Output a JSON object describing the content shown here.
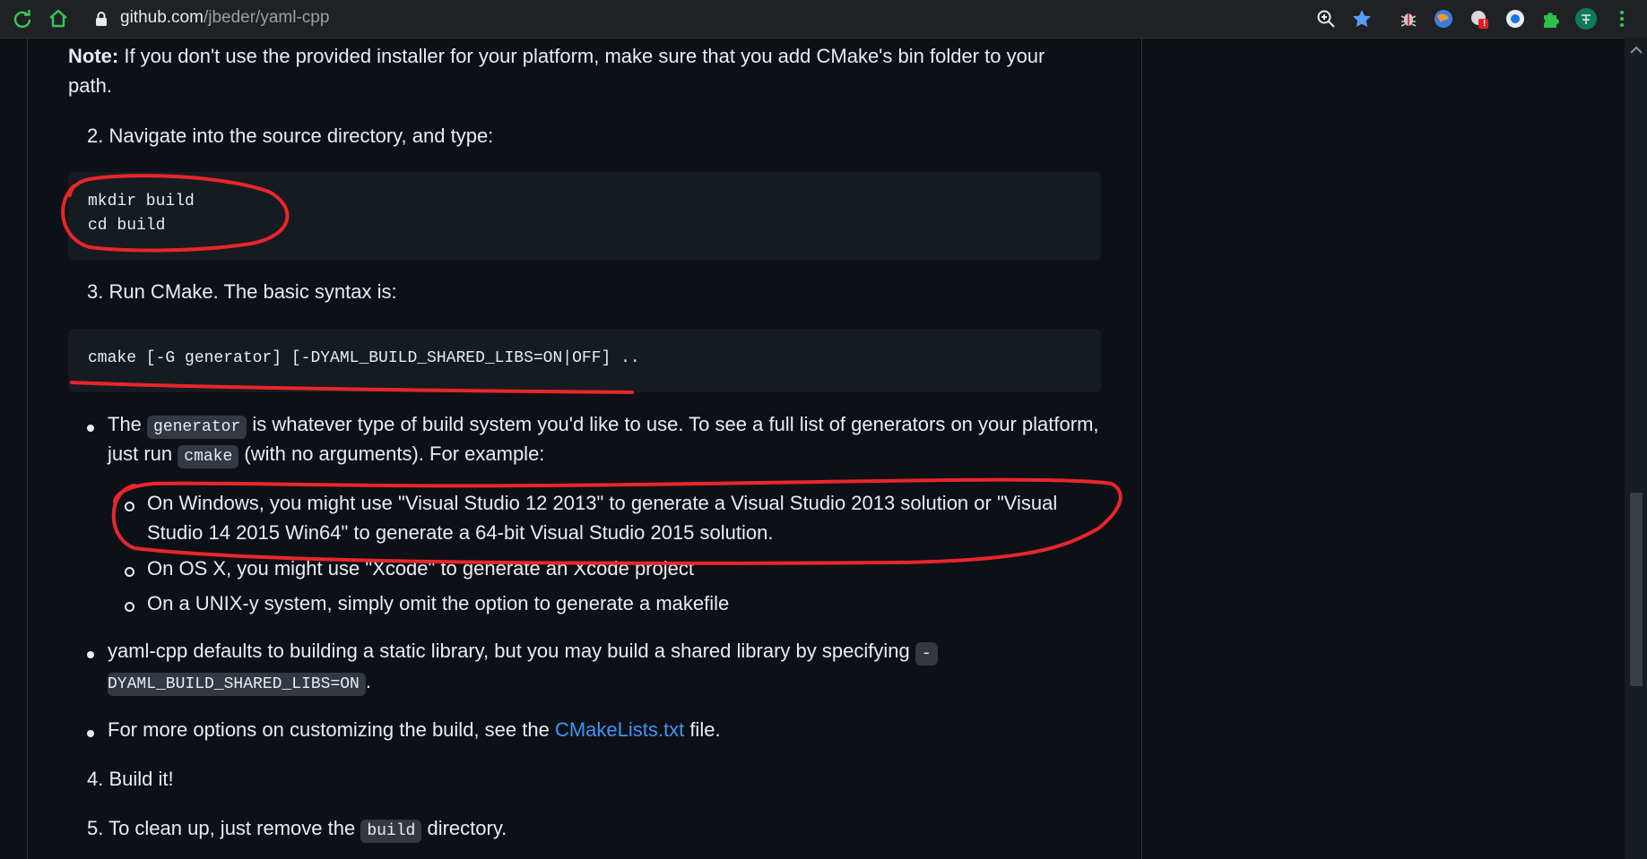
{
  "browser": {
    "url_host": "github.com",
    "url_path": "/jbeder/yaml-cpp",
    "extension_badge": "!"
  },
  "readme": {
    "note_label": "Note:",
    "note_text_line1": " If you don't use the provided installer for your platform, make sure that you add CMake's bin folder to your",
    "note_text_line2": "path.",
    "step2": "2. Navigate into the source directory, and type:",
    "step2_code": [
      "mkdir build",
      "cd build"
    ],
    "step3": "3. Run CMake. The basic syntax is:",
    "step3_code": "cmake [-G generator] [-DYAML_BUILD_SHARED_LIBS=ON|OFF] ..",
    "bullet1": {
      "pre": "The ",
      "code1": "generator",
      "mid": " is whatever type of build system you'd like to use. To see a full list of generators on your platform,",
      "line2_pre": "just run ",
      "code2": "cmake",
      "line2_post": " (with no arguments). For example:"
    },
    "sub1_line1": "On Windows, you might use \"Visual Studio 12 2013\" to generate a Visual Studio 2013 solution or \"Visual",
    "sub1_line2": "Studio 14 2015 Win64\" to generate a 64-bit Visual Studio 2015 solution.",
    "sub2": "On OS X, you might use \"Xcode\" to generate an Xcode project",
    "sub3": "On a UNIX-y system, simply omit the option to generate a makefile",
    "bullet2": {
      "text": "yaml-cpp defaults to building a static library, but you may build a shared library by specifying ",
      "code_line1": "-",
      "code_line2": "DYAML_BUILD_SHARED_LIBS=ON",
      "post": "."
    },
    "bullet3": {
      "pre": "For more options on customizing the build, see the ",
      "link": "CMakeLists.txt",
      "post": " file."
    },
    "step4": "4. Build it!",
    "step5": {
      "pre": "5. To clean up, just remove the ",
      "code": "build",
      "post": " directory."
    }
  },
  "colors": {
    "page_bg": "#0d1117",
    "code_bg": "#161b22",
    "link": "#4493f8",
    "annotation": "#e8262b"
  },
  "icons": [
    "reload-icon",
    "home-icon",
    "lock-icon",
    "zoom-icon",
    "bookmark-star-icon",
    "extensions-icon",
    "profile-icon",
    "menu-icon"
  ]
}
